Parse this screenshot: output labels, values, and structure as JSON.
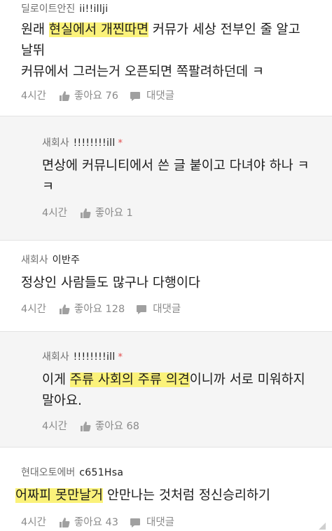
{
  "comments": [
    {
      "company": "딜로이트안진",
      "user": "ii!!illji",
      "star": "",
      "lines": [
        [
          {
            "t": "원래 "
          },
          {
            "t": "현실에서 개찐따면",
            "h": true
          },
          {
            "t": " 커뮤가 세상 전부인 줄 알고"
          }
        ],
        [
          {
            "t": "날뛰"
          }
        ],
        [
          {
            "t": "커뮤에서 그러는거 오픈되면 쪽팔려하던데 ㅋ"
          }
        ]
      ],
      "time": "4시간",
      "likes": "좋아요 76",
      "reply": "대댓글"
    },
    {
      "company": "새회사",
      "user": "!!!!!!!!ill",
      "star": "*",
      "lines": [
        [
          {
            "t": "면상에 커뮤니티에서 쓴 글 붙이고 다녀야 하나 ㅋ"
          }
        ],
        [
          {
            "t": "ㅋ"
          }
        ]
      ],
      "time": "4시간",
      "likes": "좋아요 1",
      "reply": ""
    },
    {
      "company": "새회사",
      "user": "이반주",
      "star": "",
      "lines": [
        [
          {
            "t": "정상인 사람들도 많구나 다행이다"
          }
        ]
      ],
      "time": "4시간",
      "likes": "좋아요 128",
      "reply": "대댓글"
    },
    {
      "company": "새회사",
      "user": "!!!!!!!!ill",
      "star": "*",
      "lines": [
        [
          {
            "t": "이게 "
          },
          {
            "t": "주류 사회의 주류 의견",
            "h": true
          },
          {
            "t": "이니까 서로 미워하지"
          }
        ],
        [
          {
            "t": "말아요."
          }
        ]
      ],
      "time": "4시간",
      "likes": "좋아요 68",
      "reply": ""
    },
    {
      "company": "현대오토에버",
      "user": "c651Hsa",
      "star": "",
      "lines": [
        [
          {
            "t": "어짜피 못만날거",
            "h": true
          },
          {
            "t": " 안만나는 것처럼 정신승리하기"
          }
        ]
      ],
      "time": "4시간",
      "likes": "좋아요 43",
      "reply": "대댓글"
    }
  ],
  "icons": {
    "like": "thumbs-up-icon",
    "reply": "speech-bubble-icon"
  },
  "colors": {
    "highlight": "#fbf27a",
    "reply_background": "#f5f5f5",
    "star": "#e24a4a",
    "meta_gray": "#8a8a8a"
  }
}
